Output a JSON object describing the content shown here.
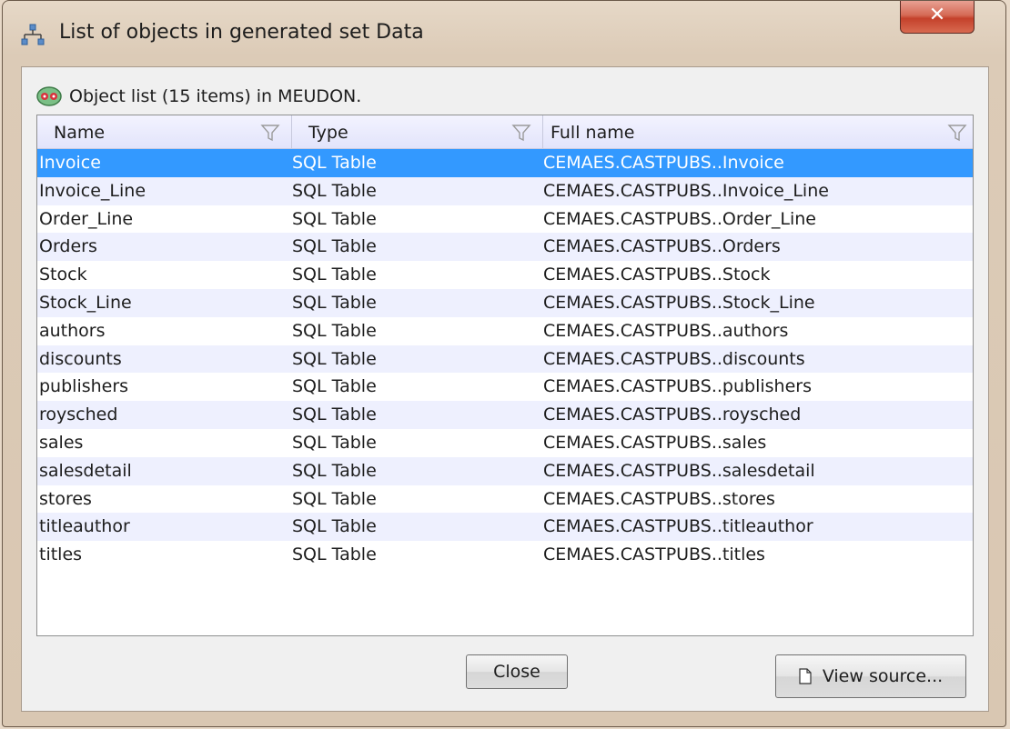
{
  "window": {
    "title": "List of objects in generated set Data",
    "close_glyph": "✕",
    "icon": "hierarchy-icon"
  },
  "subtitle": {
    "icon": "object-list-icon",
    "text": "Object list (15 items) in MEUDON."
  },
  "table": {
    "columns": [
      {
        "label": "Name",
        "filter_icon": "filter-icon"
      },
      {
        "label": "Type",
        "filter_icon": "filter-icon"
      },
      {
        "label": "Full name",
        "filter_icon": "filter-icon"
      }
    ],
    "rows": [
      {
        "name": "Invoice",
        "type": "SQL Table",
        "full_name": "CEMAES.CASTPUBS..Invoice"
      },
      {
        "name": "Invoice_Line",
        "type": "SQL Table",
        "full_name": "CEMAES.CASTPUBS..Invoice_Line"
      },
      {
        "name": "Order_Line",
        "type": "SQL Table",
        "full_name": "CEMAES.CASTPUBS..Order_Line"
      },
      {
        "name": "Orders",
        "type": "SQL Table",
        "full_name": "CEMAES.CASTPUBS..Orders"
      },
      {
        "name": "Stock",
        "type": "SQL Table",
        "full_name": "CEMAES.CASTPUBS..Stock"
      },
      {
        "name": "Stock_Line",
        "type": "SQL Table",
        "full_name": "CEMAES.CASTPUBS..Stock_Line"
      },
      {
        "name": "authors",
        "type": "SQL Table",
        "full_name": "CEMAES.CASTPUBS..authors"
      },
      {
        "name": "discounts",
        "type": "SQL Table",
        "full_name": "CEMAES.CASTPUBS..discounts"
      },
      {
        "name": "publishers",
        "type": "SQL Table",
        "full_name": "CEMAES.CASTPUBS..publishers"
      },
      {
        "name": "roysched",
        "type": "SQL Table",
        "full_name": "CEMAES.CASTPUBS..roysched"
      },
      {
        "name": "sales",
        "type": "SQL Table",
        "full_name": "CEMAES.CASTPUBS..sales"
      },
      {
        "name": "salesdetail",
        "type": "SQL Table",
        "full_name": "CEMAES.CASTPUBS..salesdetail"
      },
      {
        "name": "stores",
        "type": "SQL Table",
        "full_name": "CEMAES.CASTPUBS..stores"
      },
      {
        "name": "titleauthor",
        "type": "SQL Table",
        "full_name": "CEMAES.CASTPUBS..titleauthor"
      },
      {
        "name": "titles",
        "type": "SQL Table",
        "full_name": "CEMAES.CASTPUBS..titles"
      }
    ],
    "selected_row": 0
  },
  "buttons": {
    "close_label": "Close",
    "view_source_label": "View source...",
    "view_source_icon": "document-icon"
  },
  "colors": {
    "selection": "#3399ff",
    "alt_row": "#eef0fe",
    "header": "#e2e4fb",
    "close_button": "#c4412b"
  }
}
